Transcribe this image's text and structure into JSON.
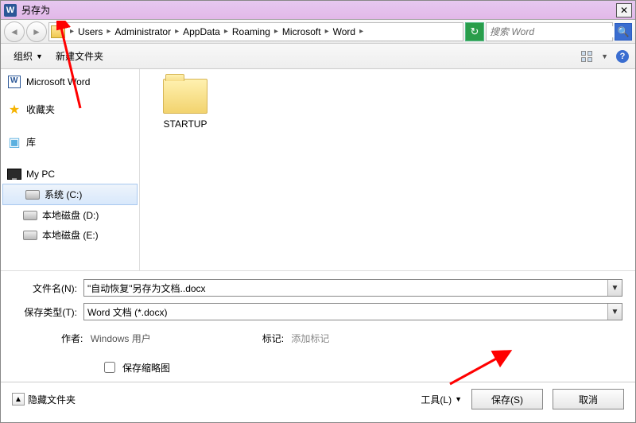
{
  "title": "另存为",
  "breadcrumb": {
    "segments": [
      "Users",
      "Administrator",
      "AppData",
      "Roaming",
      "Microsoft",
      "Word"
    ]
  },
  "search": {
    "placeholder": "搜索 Word"
  },
  "toolbar": {
    "organize": "组织",
    "new_folder": "新建文件夹"
  },
  "sidebar": {
    "word": "Microsoft Word",
    "favorites": "收藏夹",
    "library": "库",
    "mypc": "My PC",
    "drives": {
      "c": "系统 (C:)",
      "d": "本地磁盘 (D:)",
      "e": "本地磁盘 (E:)"
    }
  },
  "content": {
    "folder1_name": "STARTUP"
  },
  "fields": {
    "filename_label": "文件名(N):",
    "filename_value": "\"自动恢复\"另存为文档..docx",
    "filetype_label": "保存类型(T):",
    "filetype_value": "Word 文档 (*.docx)"
  },
  "meta": {
    "author_label": "作者:",
    "author_value": "Windows 用户",
    "tag_label": "标记:",
    "tag_placeholder": "添加标记"
  },
  "thumb": {
    "label": "保存缩略图"
  },
  "footer": {
    "hide_folders": "隐藏文件夹",
    "tools": "工具(L)",
    "save": "保存(S)",
    "cancel": "取消"
  }
}
